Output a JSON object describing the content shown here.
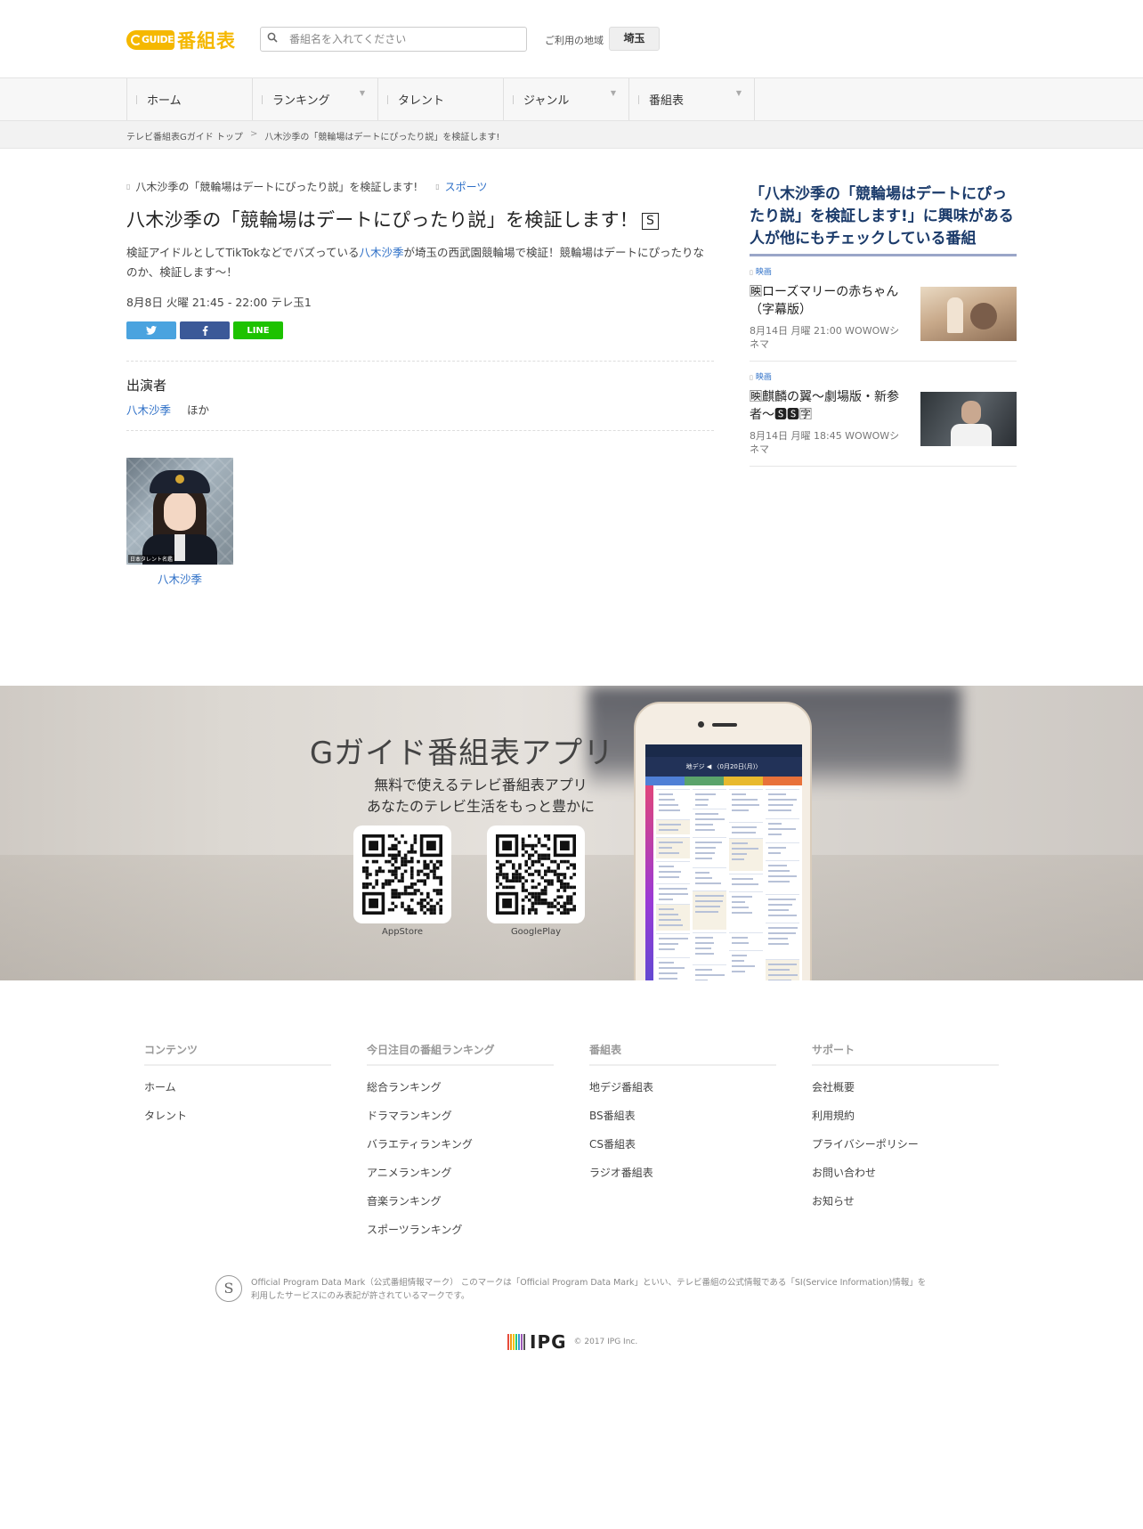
{
  "header": {
    "logo_g": "GUIDE",
    "logo_text": "番組表",
    "search_placeholder": "番組名を入れてください",
    "region_label": "ご利用の地域",
    "region_value": "埼玉"
  },
  "nav": {
    "items": [
      {
        "label": "ホーム"
      },
      {
        "label": "ランキング"
      },
      {
        "label": "タレント"
      },
      {
        "label": "ジャンル"
      },
      {
        "label": "番組表"
      }
    ]
  },
  "breadcrumb": {
    "home": "テレビ番組表Gガイド トップ",
    "separator": ">",
    "current": "八木沙季の「競輪場はデートにぴったり説」を検証します!"
  },
  "program": {
    "series": "八木沙季の「競輪場はデートにぴったり説」を検証します!",
    "genre": "スポーツ",
    "title": "八木沙季の「競輪場はデートにぴったり説」を検証します！",
    "badge": "S",
    "desc_pre": "検証アイドルとしてTikTokなどでバズっている",
    "desc_talent": "八木沙季",
    "desc_post": "が埼玉の西武園競輪場で検証！競輪場はデートにぴったりなのか、検証します〜！",
    "time": "8月8日 火曜 21:45  - 22:00 テレ玉1",
    "share_line": "LINE",
    "cast_heading": "出演者",
    "cast_name": "八木沙季",
    "cast_more": "ほか",
    "talent_caption": "八木沙季",
    "talent_photo_credit": "日本タレント名鑑"
  },
  "sidebar": {
    "heading": "「八木沙季の「競輪場はデートにぴったり説」を検証します!」に興味がある人が他にもチェックしている番組",
    "items": [
      {
        "category": "映画",
        "title": "🈙ローズマリーの赤ちゃん（字幕版）",
        "time": "8月14日 月曜 21:00 WOWOWシネマ"
      },
      {
        "category": "映画",
        "title": "🈙麒麟の翼〜劇場版・新参者〜🆂🆂🈑",
        "time": "8月14日 月曜 18:45 WOWOWシネマ"
      }
    ]
  },
  "app_banner": {
    "title": "Gガイド番組表アプリ",
    "sub1": "無料で使えるテレビ番組表アプリ",
    "sub2": "あなたのテレビ生活をもっと豊かに",
    "qr1_label": "AppStore",
    "qr2_label": "GooglePlay",
    "phone_header": "地デジ ◀  〈0月20日(月)〉"
  },
  "footer": {
    "columns": [
      {
        "heading": "コンテンツ",
        "links": [
          "ホーム",
          "タレント"
        ]
      },
      {
        "heading": "今日注目の番組ランキング",
        "links": [
          "総合ランキング",
          "ドラマランキング",
          "バラエティランキング",
          "アニメランキング",
          "音楽ランキング",
          "スポーツランキング"
        ]
      },
      {
        "heading": "番組表",
        "links": [
          "地デジ番組表",
          "BS番組表",
          "CS番組表",
          "ラジオ番組表"
        ]
      },
      {
        "heading": "サポート",
        "links": [
          "会社概要",
          "利用規約",
          "プライバシーポリシー",
          "お問い合わせ",
          "お知らせ"
        ]
      }
    ],
    "opm_icon": "S",
    "opm_text": "Official Program Data Mark（公式番組情報マーク） このマークは「Official Program Data Mark」といい、テレビ番組の公式情報である「SI(Service Information)情報」を利用したサービスにのみ表記が許されているマークです。",
    "ipg_logo": "IPG",
    "copyright": "© 2017 IPG Inc."
  },
  "colors": {
    "brand_yellow": "#f5b800",
    "link_blue": "#2d6fc7",
    "twitter": "#4aa3df",
    "facebook": "#3b5998",
    "line": "#1dc200"
  }
}
